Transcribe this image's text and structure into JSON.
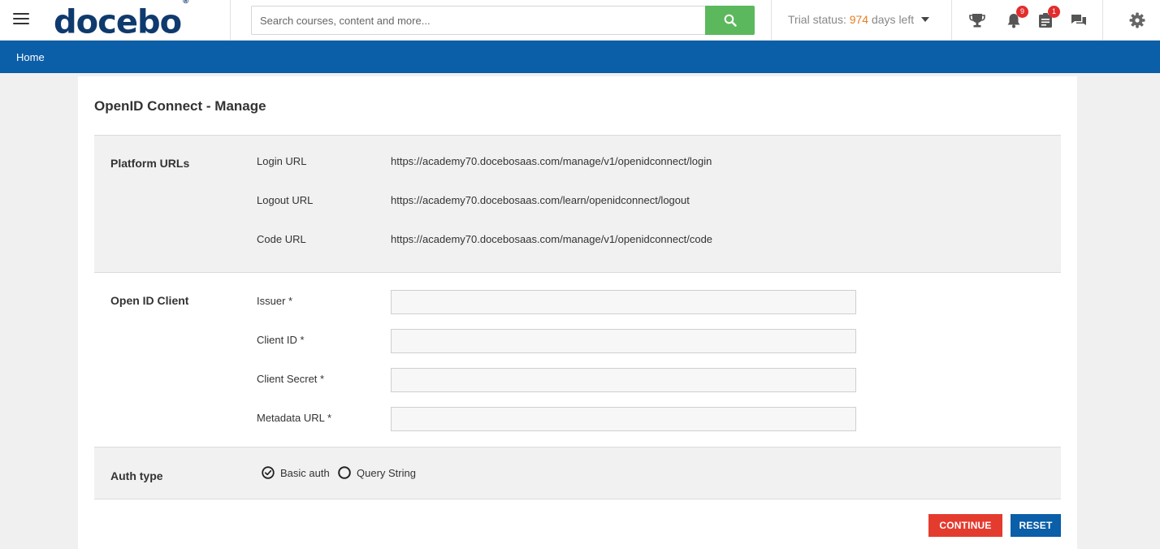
{
  "app": {
    "logo_text": "docebo",
    "logo_mark": "®"
  },
  "header": {
    "search_placeholder": "Search courses, content and more...",
    "trial_prefix": "Trial status:",
    "trial_days": "974",
    "trial_suffix": "days left",
    "notifications_count": "9",
    "assignments_count": "1",
    "icons": [
      "menu-icon",
      "search-icon",
      "trophy-icon",
      "bell-icon",
      "clipboard-icon",
      "chat-icon",
      "gear-icon"
    ],
    "colors": {
      "search_button": "#5cb85c",
      "trial_days": "#e67e22",
      "badge": "#e32c2c"
    }
  },
  "nav": {
    "home_label": "Home",
    "color": "#0b5ea8"
  },
  "page": {
    "title": "OpenID Connect - Manage"
  },
  "platform_urls": {
    "section_label": "Platform URLs",
    "rows": [
      {
        "label": "Login URL",
        "value": "https://academy70.docebosaas.com/manage/v1/openidconnect/login"
      },
      {
        "label": "Logout URL",
        "value": "https://academy70.docebosaas.com/learn/openidconnect/logout"
      },
      {
        "label": "Code URL",
        "value": "https://academy70.docebosaas.com/manage/v1/openidconnect/code"
      }
    ]
  },
  "openid_client": {
    "section_label": "Open ID Client",
    "fields": [
      {
        "label": "Issuer *",
        "value": ""
      },
      {
        "label": "Client ID *",
        "value": ""
      },
      {
        "label": "Client Secret *",
        "value": ""
      },
      {
        "label": "Metadata URL *",
        "value": ""
      }
    ]
  },
  "auth_type": {
    "section_label": "Auth type",
    "options": [
      {
        "label": "Basic auth",
        "selected": true
      },
      {
        "label": "Query String",
        "selected": false
      }
    ]
  },
  "actions": {
    "continue_label": "CONTINUE",
    "reset_label": "RESET",
    "colors": {
      "continue": "#e43b2f",
      "reset": "#0b5ea8"
    }
  }
}
